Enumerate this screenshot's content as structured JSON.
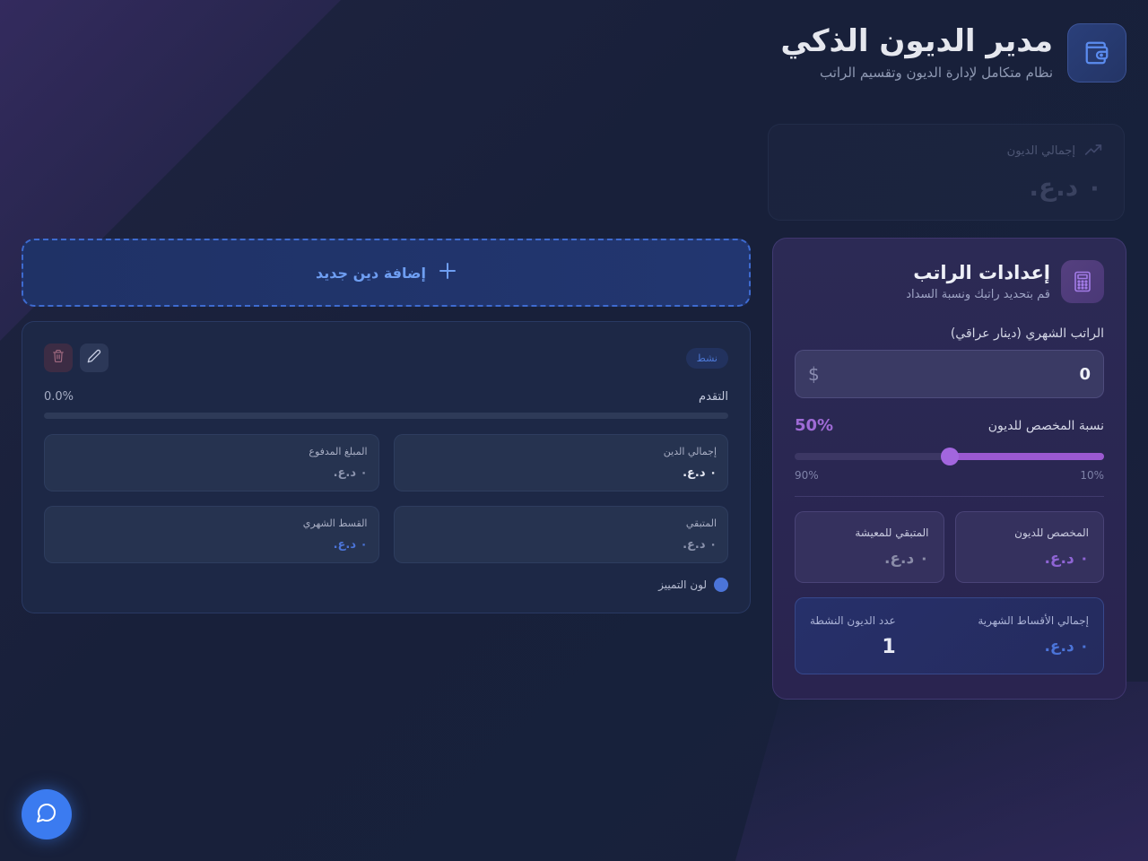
{
  "header": {
    "title": "مدير الديون الذكي",
    "subtitle": "نظام متكامل لإدارة الديون وتقسيم الراتب"
  },
  "summary": {
    "total_label": "إجمالي الديون",
    "total_value": "٠ د.ع."
  },
  "salary_settings": {
    "title": "إعدادات الراتب",
    "subtitle": "قم بتحديد راتبك ونسبة السداد",
    "salary_label": "الراتب الشهري (دينار عراقي)",
    "salary_value": "0",
    "currency_symbol": "$",
    "ratio_label": "نسبة المخصص للديون",
    "ratio_value": "50%",
    "ratio_fraction": 0.5,
    "slider_min_label": "10%",
    "slider_max_label": "90%",
    "allocated_label": "المخصص للديون",
    "allocated_value": "٠ د.ع.",
    "living_label": "المتبقي للمعيشة",
    "living_value": "٠ د.ع.",
    "monthly_total_label": "إجمالي الأقساط الشهرية",
    "monthly_total_value": "٠ د.ع.",
    "active_count_label": "عدد الديون النشطة",
    "active_count_value": "1"
  },
  "add_debt": {
    "label": "إضافة دين جديد"
  },
  "debt_card": {
    "status": "نشط",
    "progress_label": "التقدم",
    "progress_value": "0.0%",
    "progress_fraction": 0.0,
    "total_label": "إجمالي الدين",
    "total_value": "٠ د.ع.",
    "paid_label": "المبلغ المدفوع",
    "paid_value": "٠ د.ع.",
    "remaining_label": "المتبقي",
    "remaining_value": "٠ د.ع.",
    "installment_label": "القسط الشهري",
    "installment_value": "٠ د.ع.",
    "color_label": "لون التمييز",
    "accent_color": "#4b74d8"
  },
  "colors": {
    "primary_blue": "#3b7bf0",
    "accent_purple": "#9b59d1"
  },
  "icons": {
    "logo": "wallet-icon",
    "trend": "trending-up-icon",
    "calculator": "calculator-icon",
    "edit": "pencil-icon",
    "delete": "trash-icon",
    "chat": "chat-bubble-icon"
  }
}
